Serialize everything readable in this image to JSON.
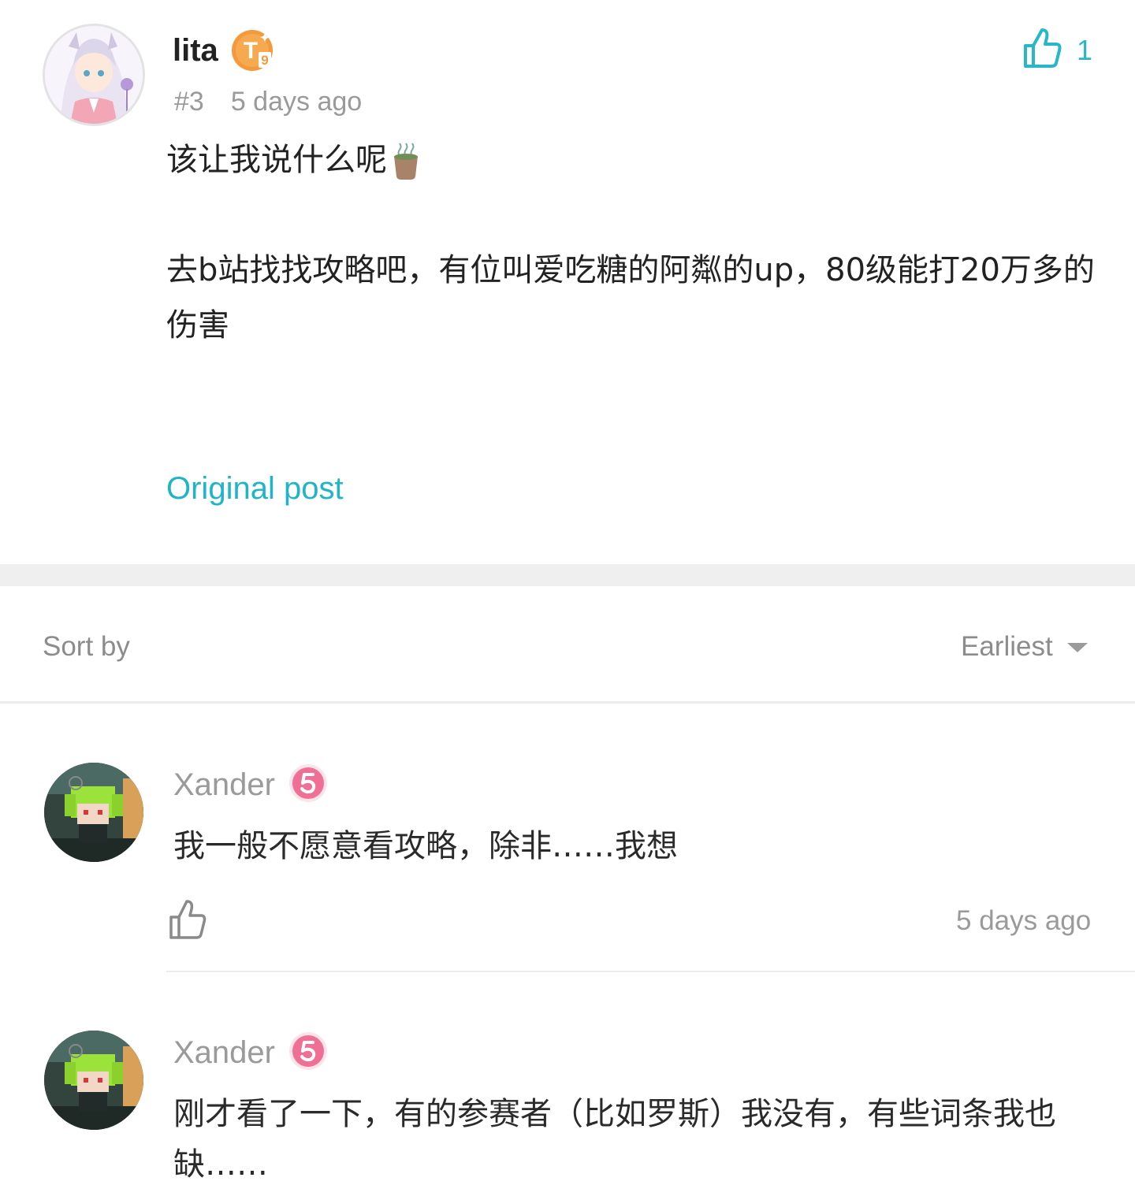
{
  "post": {
    "author": "lita",
    "level_badge": "T9",
    "floor": "#3",
    "time": "5 days ago",
    "likes": "1",
    "body_line1": "该让我说什么呢",
    "body_line1_icon": "tea-cup-emoji",
    "body_line2": "去b站找找攻略吧，有位叫爱吃糖的阿粼的up，80级能打20万多的伤害",
    "original_link": "Original post"
  },
  "sort": {
    "label": "Sort by",
    "value": "Earliest"
  },
  "replies": [
    {
      "author": "Xander",
      "level_badge": "5",
      "text": "我一般不愿意看攻略，除非……我想",
      "time": "5 days ago"
    },
    {
      "author": "Xander",
      "level_badge": "5",
      "text": "刚才看了一下，有的参赛者（比如罗斯）我没有，有些词条我也缺……"
    }
  ],
  "colors": {
    "accent": "#1fb5c8",
    "badge_t": "#f59a3c",
    "badge_5": "#f06f95",
    "muted": "#9a9a9a"
  }
}
